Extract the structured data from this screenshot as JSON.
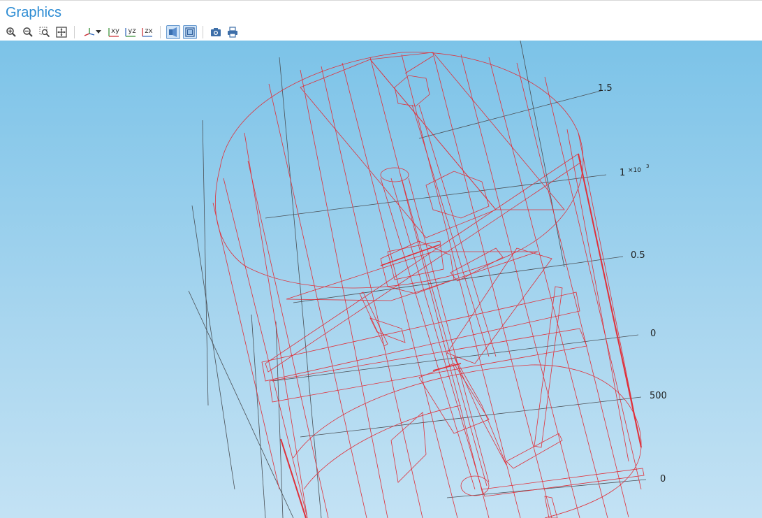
{
  "panel": {
    "title": "Graphics"
  },
  "toolbar": {
    "buttons": [
      {
        "name": "zoom-in-button",
        "icon": "zoom-in-icon"
      },
      {
        "name": "zoom-out-button",
        "icon": "zoom-out-icon"
      },
      {
        "name": "zoom-box-button",
        "icon": "zoom-box-icon"
      },
      {
        "name": "zoom-extents-button",
        "icon": "zoom-extents-icon"
      },
      {
        "name": "view-axes-button",
        "icon": "axes-icon"
      },
      {
        "name": "view-xy-button",
        "label": "xy",
        "icon": "xy-plane-icon"
      },
      {
        "name": "view-yz-button",
        "label": "yz",
        "icon": "yz-plane-icon"
      },
      {
        "name": "view-zx-button",
        "label": "zx",
        "icon": "zx-plane-icon"
      },
      {
        "name": "transparency-button",
        "icon": "transparency-icon",
        "active": true
      },
      {
        "name": "wireframe-button",
        "icon": "wireframe-icon",
        "active": true
      },
      {
        "name": "screenshot-button",
        "icon": "camera-icon"
      },
      {
        "name": "print-button",
        "icon": "print-icon"
      }
    ],
    "xy_label": "xy",
    "yz_label": "yz",
    "zx_label": "zx"
  },
  "viewport": {
    "axis_labels": {
      "t1": "1.5",
      "t2": "1",
      "t2_exp": "×10",
      "t2_pow": "3",
      "t3": "0.5",
      "t4": "0",
      "t5": "500",
      "t6": "0"
    },
    "colors": {
      "wire": "#e0303a",
      "grid": "#4a4f55",
      "bg_top": "#7cc3e8",
      "bg_bottom": "#c3e2f4"
    }
  }
}
